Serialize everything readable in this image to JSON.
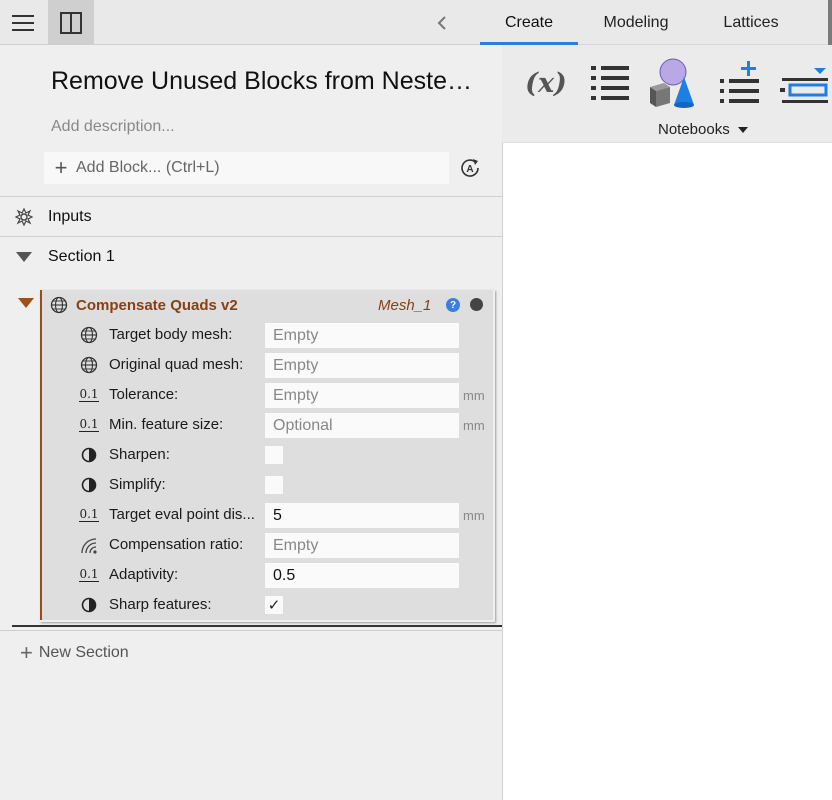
{
  "toolbar": {
    "menu_icon": "hamburger-icon",
    "panel_icon": "panel-toggle-icon",
    "back_icon": "chevron-left-icon"
  },
  "tabs": [
    {
      "label": "Create",
      "active": true
    },
    {
      "label": "Modeling",
      "active": false
    },
    {
      "label": "Lattices",
      "active": false
    }
  ],
  "ribbon": {
    "icons": [
      "variable-icon",
      "list-icon",
      "primitives-icon",
      "add-list-icon",
      "dropdown-input-icon"
    ],
    "variable_glyph": "(x)",
    "group_label": "Notebooks"
  },
  "notebook": {
    "title": "Remove Unused Blocks from Nested Notebooks",
    "description_placeholder": "Add description...",
    "add_block_label": "Add Block... (Ctrl+L)",
    "inputs_label": "Inputs",
    "section_label": "Section 1",
    "new_section_label": "New Section"
  },
  "block": {
    "title": "Compensate Quads v2",
    "output": "Mesh_1",
    "help_glyph": "?",
    "params": [
      {
        "icon": "mesh-icon",
        "label": "Target body mesh:",
        "value": "Empty",
        "unit": "",
        "kind": "input",
        "filled": false
      },
      {
        "icon": "mesh-icon",
        "label": "Original quad mesh:",
        "value": "Empty",
        "unit": "",
        "kind": "input",
        "filled": false
      },
      {
        "icon": "number-icon",
        "label": "Tolerance:",
        "value": "Empty",
        "unit": "mm",
        "kind": "input",
        "filled": false
      },
      {
        "icon": "number-icon",
        "label": "Min. feature size:",
        "value": "Optional",
        "unit": "mm",
        "kind": "input",
        "filled": false
      },
      {
        "icon": "boolean-icon",
        "label": "Sharpen:",
        "value": "",
        "unit": "",
        "kind": "check",
        "checked": false
      },
      {
        "icon": "boolean-icon",
        "label": "Simplify:",
        "value": "",
        "unit": "",
        "kind": "check",
        "checked": false
      },
      {
        "icon": "number-icon",
        "label": "Target eval point dis...",
        "value": "5",
        "unit": "mm",
        "kind": "input",
        "filled": true
      },
      {
        "icon": "ratio-icon",
        "label": "Compensation ratio:",
        "value": "Empty",
        "unit": "",
        "kind": "input",
        "filled": false
      },
      {
        "icon": "number-icon",
        "label": "Adaptivity:",
        "value": "0.5",
        "unit": "",
        "kind": "input",
        "filled": true
      },
      {
        "icon": "boolean-icon",
        "label": "Sharp features:",
        "value": "",
        "unit": "",
        "kind": "check",
        "checked": true
      }
    ],
    "number_icon_glyph": "0.1",
    "check_glyph": "✓"
  },
  "colors": {
    "accent": "#2d7fd6",
    "block_title": "#8a3f12",
    "block_border": "#9b4a1a",
    "help": "#3b7fe0"
  }
}
